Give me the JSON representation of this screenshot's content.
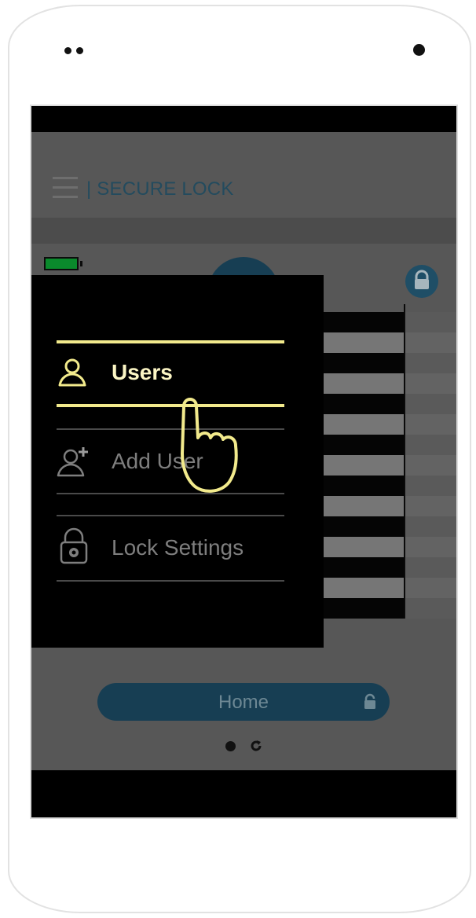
{
  "app": {
    "title": "| SECURE LOCK"
  },
  "drawer": {
    "items": [
      {
        "label": "Users",
        "icon": "user-icon",
        "active": true
      },
      {
        "label": "Add User",
        "icon": "add-user-icon",
        "active": false
      },
      {
        "label": "Lock Settings",
        "icon": "lock-gear-icon",
        "active": false
      }
    ]
  },
  "home_button": {
    "label": "Home",
    "icon": "lock-icon"
  },
  "pager": {
    "dot": "page-dot",
    "refresh": "refresh-icon"
  },
  "colors": {
    "accent": "#173e53",
    "highlight": "#f2ea8c",
    "battery": "#0a8a2c",
    "scrim": "#575757"
  }
}
